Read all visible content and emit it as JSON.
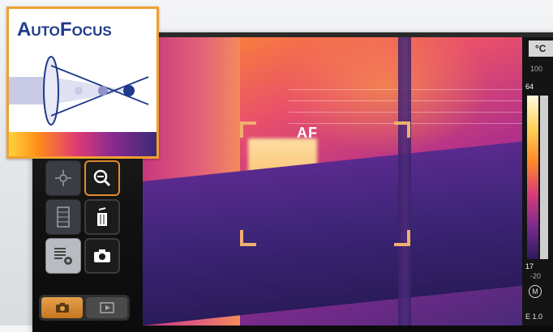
{
  "badge": {
    "title": "AutoFocus"
  },
  "viewfinder": {
    "af_label": "AF"
  },
  "scale": {
    "unit": "°C",
    "top_value": "100",
    "max_value": "64",
    "min_value": "17",
    "bottom_value": "-20",
    "mode_icon": "M",
    "e_label": "E 1.0"
  },
  "toolbar": {
    "buttons": [
      {
        "icon": "focus-target-icon"
      },
      {
        "icon": "zoom-icon"
      },
      {
        "icon": "palette-icon"
      },
      {
        "icon": "delete-icon"
      },
      {
        "icon": "settings-hand-icon"
      },
      {
        "icon": "camera-icon"
      }
    ]
  },
  "bottom_tabs": [
    {
      "icon": "camera-icon",
      "active": true
    },
    {
      "icon": "play-icon",
      "active": false
    }
  ],
  "colors": {
    "badge_border": "#f0a030",
    "badge_title": "#1f3a8a",
    "af_brackets": "#f0b070",
    "active_tab": "#e6a04c"
  }
}
